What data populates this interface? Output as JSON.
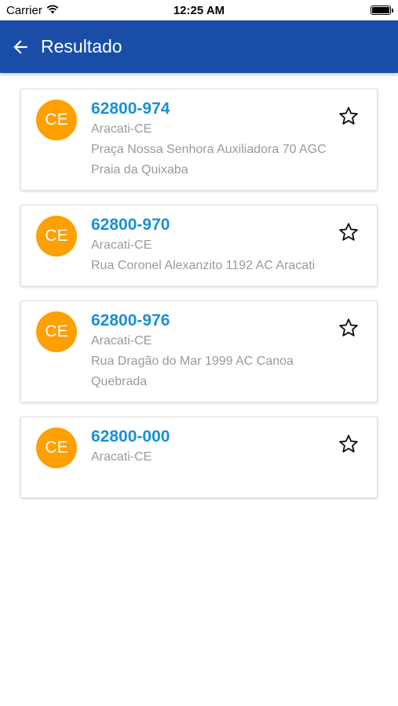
{
  "status_bar": {
    "carrier": "Carrier",
    "time": "12:25 AM"
  },
  "app_bar": {
    "title": "Resultado",
    "color": "#1a4da8"
  },
  "results": [
    {
      "badge": "CE",
      "cep": "62800-974",
      "city": "Aracati-CE",
      "address": "Praça Nossa Senhora Auxiliadora 70  AGC Praia da Quixaba"
    },
    {
      "badge": "CE",
      "cep": "62800-970",
      "city": "Aracati-CE",
      "address": "Rua Coronel Alexanzito 1192  AC Aracati"
    },
    {
      "badge": "CE",
      "cep": "62800-976",
      "city": "Aracati-CE",
      "address": "Rua Dragão do Mar 1999  AC Canoa Quebrada"
    },
    {
      "badge": "CE",
      "cep": "62800-000",
      "city": "Aracati-CE",
      "address": ""
    }
  ],
  "colors": {
    "badge": "#ff9f00",
    "cep": "#1a90d6",
    "secondary_text": "#9a9a9a"
  },
  "icons": {
    "back": "arrow-left-icon",
    "favorite": "star-outline-icon"
  }
}
